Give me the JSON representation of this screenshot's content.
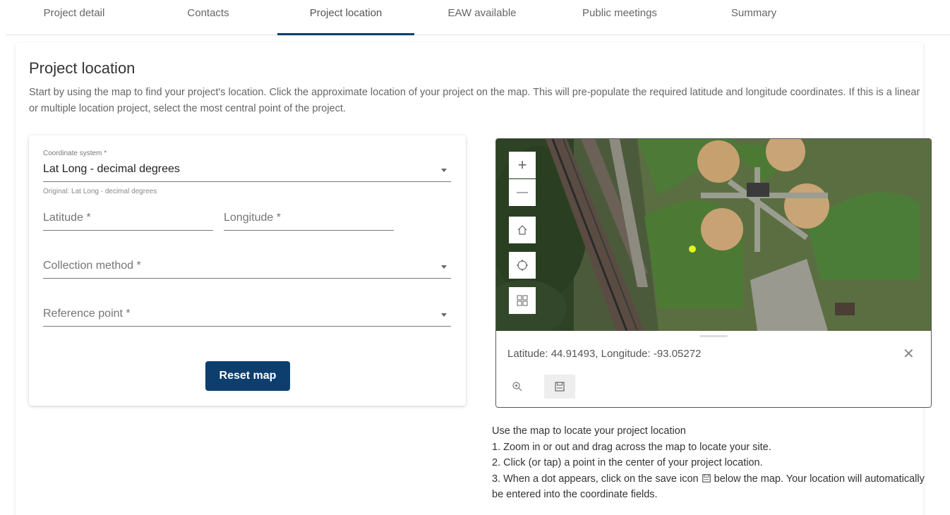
{
  "tabs": [
    {
      "label": "Project detail"
    },
    {
      "label": "Contacts"
    },
    {
      "label": "Project location",
      "active": true
    },
    {
      "label": "EAW available"
    },
    {
      "label": "Public meetings"
    },
    {
      "label": "Summary"
    }
  ],
  "page": {
    "title": "Project location",
    "description": "Start by using the map to find your project's location. Click the approximate location of your project on the map. This will pre-populate the required latitude and longitude coordinates. If this is a linear or multiple location project, select the most central point of the project."
  },
  "form": {
    "coordinate_system": {
      "label": "Coordinate system *",
      "value": "Lat Long - decimal degrees",
      "hint": "Original: Lat Long - decimal degrees"
    },
    "latitude": {
      "placeholder": "Latitude *",
      "value": ""
    },
    "longitude": {
      "placeholder": "Longitude *",
      "value": ""
    },
    "collection_method": {
      "placeholder": "Collection method *"
    },
    "reference_point": {
      "placeholder": "Reference point *"
    },
    "reset_button": "Reset map"
  },
  "map": {
    "controls": [
      "zoom-in",
      "zoom-out",
      "home",
      "locate",
      "basemap-gallery"
    ],
    "zoom_in_glyph": "+",
    "zoom_out_glyph": "—",
    "popup": {
      "coordinates": "Latitude: 44.91493, Longitude: -93.05272",
      "close_glyph": "✕"
    },
    "marker_color": "#e6f51a"
  },
  "instructions": {
    "heading": "Use the map to locate your project location",
    "step1": "1. Zoom in or out and drag across the map to locate your site.",
    "step2": "2. Click (or tap) a point in the center of your project location.",
    "step3_before": "3. When a dot appears, click on the save icon",
    "step3_after": "below the map. Your location will automatically be entered into the coordinate fields."
  },
  "colors": {
    "primary": "#0d3e6e",
    "tab_active_underline": "#0d3e6e"
  }
}
